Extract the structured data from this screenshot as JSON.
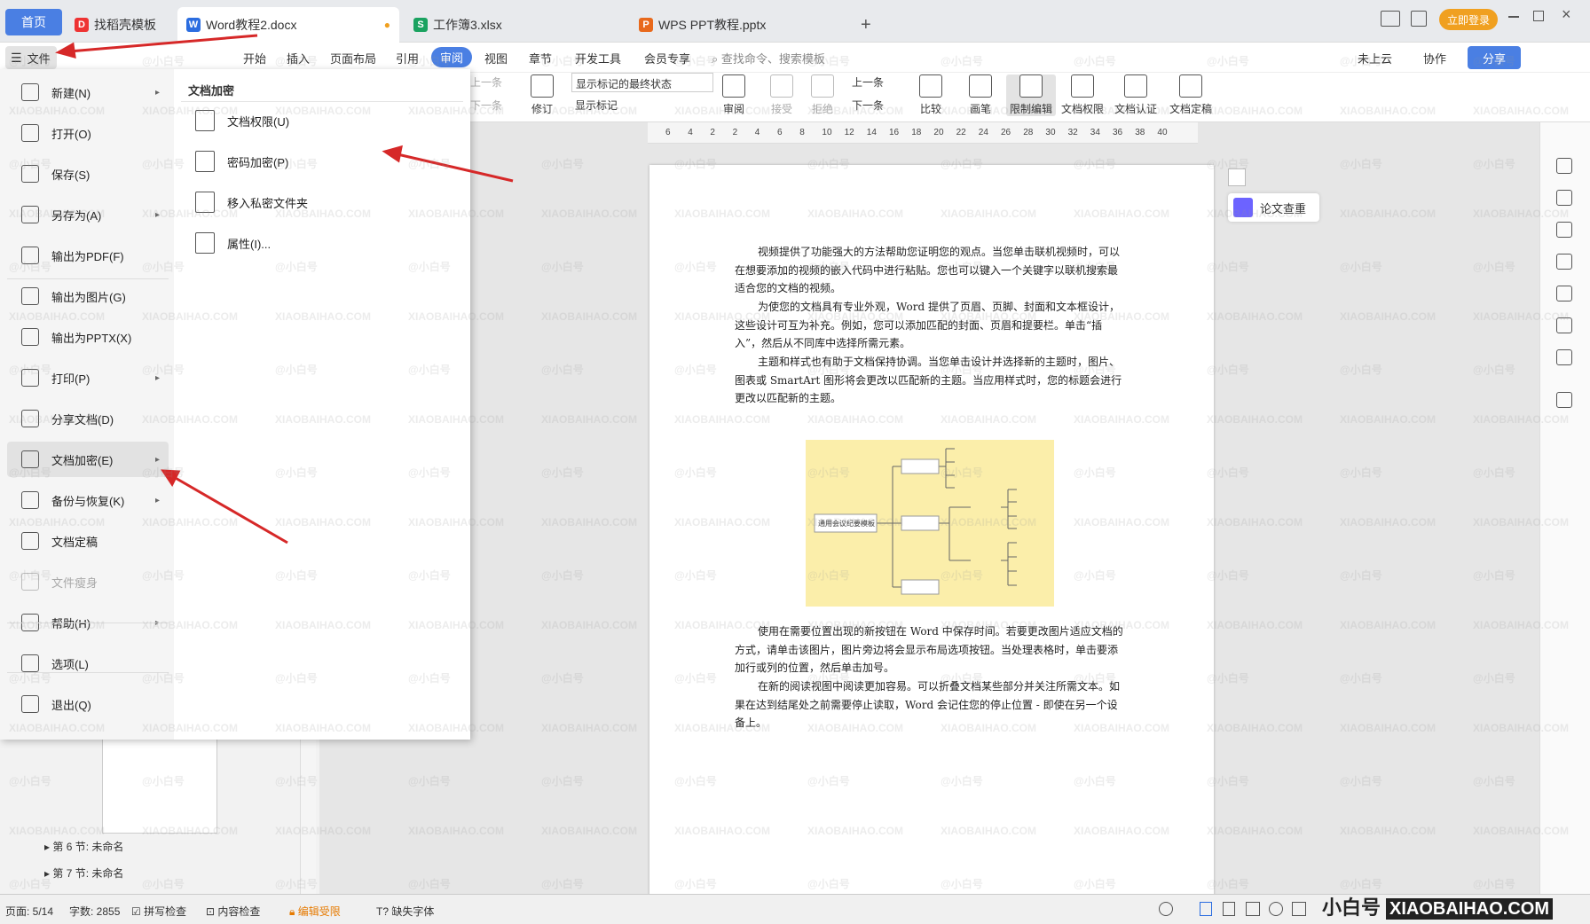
{
  "tabs": {
    "home": "首页",
    "tab1": "找稻壳模板",
    "tab2": "Word教程2.docx",
    "tab3": "工作簿3.xlsx",
    "tab4": "WPS PPT教程.pptx",
    "new_tab": "+",
    "login": "立即登录"
  },
  "menu": {
    "file": "文件",
    "items": [
      "开始",
      "插入",
      "页面布局",
      "引用",
      "审阅",
      "视图",
      "章节",
      "开发工具",
      "会员专享"
    ],
    "search_placeholder": "查找命令、搜索模板",
    "cloud": "未上云",
    "collab": "协作",
    "share": "分享"
  },
  "ribbon": {
    "prev_disabled": "上一条",
    "next_disabled": "下一条",
    "show_markup": "显示标记的最终状态",
    "track": "修订",
    "show_marks": "显示标记",
    "review": "审阅",
    "accept": "接受",
    "reject": "拒绝",
    "prev": "上一条",
    "next": "下一条",
    "compare": "比较",
    "pen": "画笔",
    "restrict": "限制编辑",
    "doc_perm": "文档权限",
    "doc_auth": "文档认证",
    "doc_final": "文档定稿"
  },
  "ruler": [
    "6",
    "4",
    "2",
    "2",
    "4",
    "6",
    "8",
    "10",
    "12",
    "14",
    "16",
    "18",
    "20",
    "22",
    "24",
    "26",
    "28",
    "30",
    "32",
    "34",
    "36",
    "38",
    "40"
  ],
  "filemenu": {
    "items": [
      {
        "label": "新建(N)",
        "arrow": true
      },
      {
        "label": "打开(O)",
        "arrow": false
      },
      {
        "label": "保存(S)",
        "arrow": false
      },
      {
        "label": "另存为(A)",
        "arrow": true
      },
      {
        "label": "输出为PDF(F)",
        "arrow": false
      },
      {
        "label": "输出为图片(G)",
        "arrow": false
      },
      {
        "label": "输出为PPTX(X)",
        "arrow": false
      },
      {
        "label": "打印(P)",
        "arrow": true
      },
      {
        "label": "分享文档(D)",
        "arrow": false
      },
      {
        "label": "文档加密(E)",
        "arrow": true
      },
      {
        "label": "备份与恢复(K)",
        "arrow": true
      },
      {
        "label": "文档定稿",
        "arrow": false
      },
      {
        "label": "文件瘦身",
        "arrow": false
      },
      {
        "label": "帮助(H)",
        "arrow": true
      },
      {
        "label": "选项(L)",
        "arrow": false
      },
      {
        "label": "退出(Q)",
        "arrow": false
      }
    ],
    "submenu_title": "文档加密",
    "submenu": [
      "文档权限(U)",
      "密码加密(P)",
      "移入私密文件夹",
      "属性(I)..."
    ]
  },
  "nav": {
    "sec6": "第 6 节: 未命名",
    "sec7": "第 7 节: 未命名"
  },
  "doc": {
    "p1": "视频提供了功能强大的方法帮助您证明您的观点。当您单击联机视频时，可以在想要添加的视频的嵌入代码中进行粘贴。您也可以键入一个关键字以联机搜索最适合您的文档的视频。",
    "p2": "为使您的文档具有专业外观，Word 提供了页眉、页脚、封面和文本框设计，这些设计可互为补充。例如，您可以添加匹配的封面、页眉和提要栏。单击“插入”，然后从不同库中选择所需元素。",
    "p3": "主题和样式也有助于文档保持协调。当您单击设计并选择新的主题时，图片、图表或 SmartArt 图形将会更改以匹配新的主题。当应用样式时，您的标题会进行更改以匹配新的主题。",
    "p4": "使用在需要位置出现的新按钮在 Word 中保存时间。若要更改图片适应文档的方式，请单击该图片，图片旁边将会显示布局选项按钮。当处理表格时，单击要添加行或列的位置，然后单击加号。",
    "p5": "在新的阅读视图中阅读更加容易。可以折叠文档某些部分并关注所需文本。如果在达到结尾处之前需要停止读取，Word 会记住您的停止位置 - 即使在另一个设备上。",
    "mindmap_root": "通用会议纪要模板"
  },
  "side": {
    "paper_check": "论文查重"
  },
  "status": {
    "page": "页面: 5/14",
    "words": "字数: 2855",
    "spell": "拼写检查",
    "content": "内容检查",
    "edit_restricted": "编辑受限",
    "missing_font": "缺失字体"
  },
  "brand": {
    "cn": "小白号",
    "en": "XIAOBAIHAO.COM",
    "watermark": "@小白号",
    "watermark_en": "XIAOBAIHAO.COM"
  },
  "colors": {
    "accent": "#4a7fe3",
    "arrow": "#d62828",
    "mindmap_bg": "#fbeeaa"
  }
}
